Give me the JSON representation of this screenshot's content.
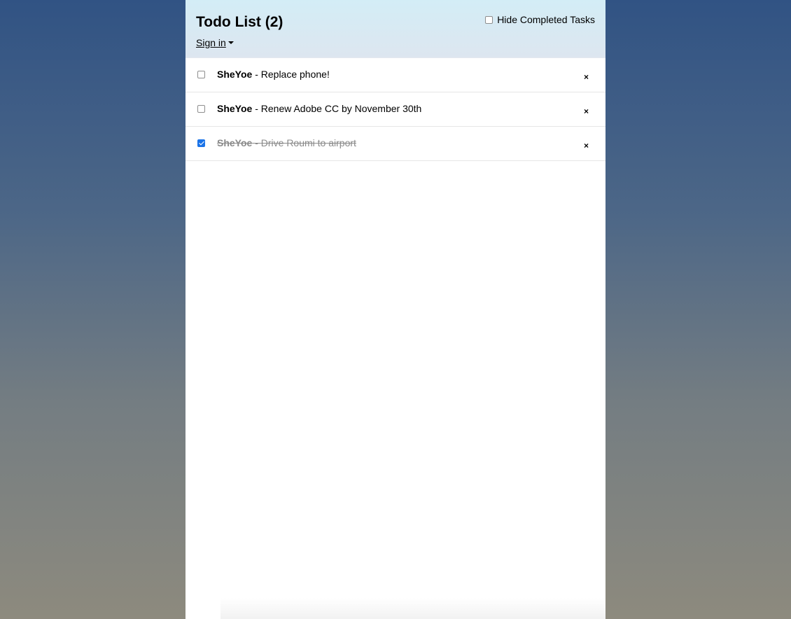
{
  "header": {
    "title": "Todo List (2)",
    "signin_label": "Sign in",
    "hide_completed_label": "Hide Completed Tasks",
    "hide_completed_checked": false
  },
  "tasks": [
    {
      "user": "SheYoe",
      "separator": " - ",
      "text": "Replace phone!",
      "checked": false,
      "delete_label": "×"
    },
    {
      "user": "SheYoe",
      "separator": " - ",
      "text": "Renew Adobe CC by November 30th",
      "checked": false,
      "delete_label": "×"
    },
    {
      "user": "SheYoe",
      "separator": " - ",
      "text": "Drive Roumi to airport",
      "checked": true,
      "delete_label": "×"
    }
  ],
  "colors": {
    "checkbox_checked": "#1a73e8",
    "completed_text": "#8a8a8a"
  }
}
